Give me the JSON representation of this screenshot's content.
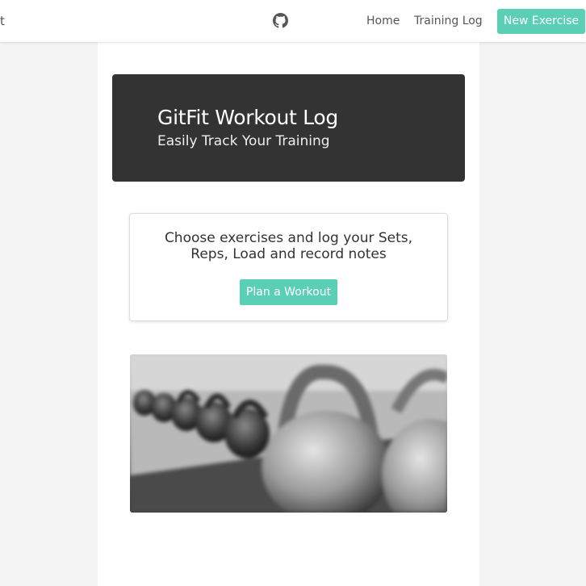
{
  "navbar": {
    "brand_fragment": "t",
    "github_icon": "github-icon",
    "links": [
      {
        "label": "Home"
      },
      {
        "label": "Training Log"
      }
    ],
    "new_exercise_label": "New Exercise"
  },
  "hero": {
    "title": "GitFit Workout Log",
    "subtitle": "Easily Track Your Training"
  },
  "plan_card": {
    "text": "Choose exercises and log your Sets, Reps, Load and record notes",
    "button_label": "Plan a Workout"
  },
  "photo": {
    "subject": "kettlebells"
  },
  "colors": {
    "accent": "#5bcfb5",
    "hero_bg": "#333333",
    "page_bg": "#f4f4f4",
    "card_bg": "#ffffff"
  }
}
